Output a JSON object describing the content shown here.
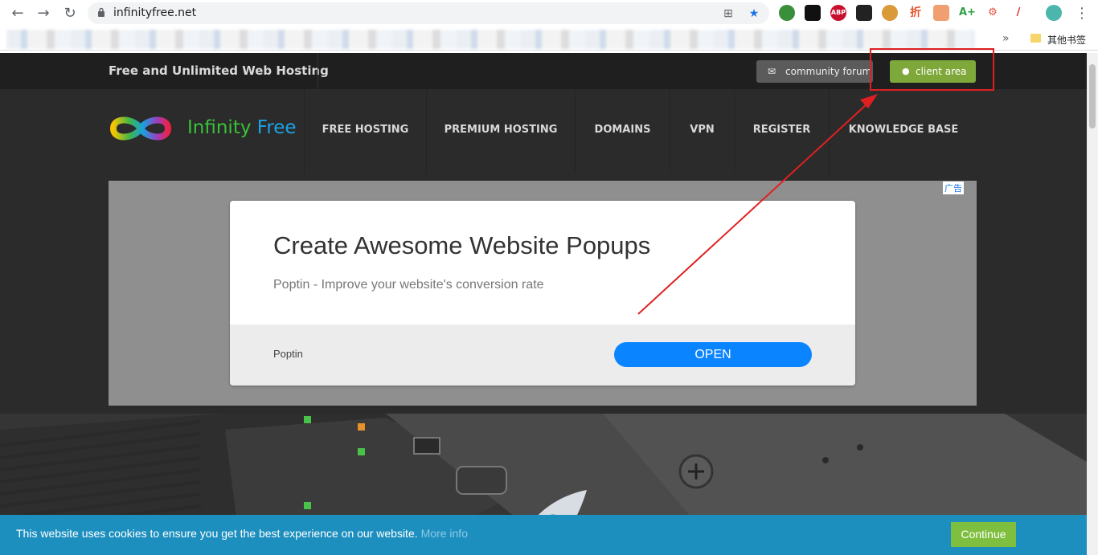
{
  "browser": {
    "url": "infinityfree.net",
    "other_bookmarks": "其他书签",
    "more_bookmarks": "»",
    "extensions": [
      "ABP",
      "折",
      "A+"
    ]
  },
  "site": {
    "tagline": "Free and Unlimited Web Hosting",
    "community_forum": "community forum",
    "client_area": "client area",
    "logo_part1": "Infinity",
    "logo_part2": "Free",
    "nav": [
      {
        "label": "FREE HOSTING"
      },
      {
        "label": "PREMIUM HOSTING"
      },
      {
        "label": "DOMAINS"
      },
      {
        "label": "VPN"
      },
      {
        "label": "REGISTER"
      },
      {
        "label": "KNOWLEDGE BASE"
      }
    ]
  },
  "ad": {
    "badge": "广告",
    "title": "Create Awesome Website Popups",
    "description": "Poptin - Improve your website's conversion rate",
    "advertiser": "Poptin",
    "cta": "OPEN"
  },
  "cookie": {
    "text": "This website uses cookies to ensure you get the best experience on our website.",
    "more_info": "More info",
    "button": "Continue"
  },
  "colors": {
    "accent_green": "#7fa83a",
    "cookie_bar": "#1d8fbf",
    "ad_button": "#0a84ff",
    "annotation_red": "#e02020"
  }
}
